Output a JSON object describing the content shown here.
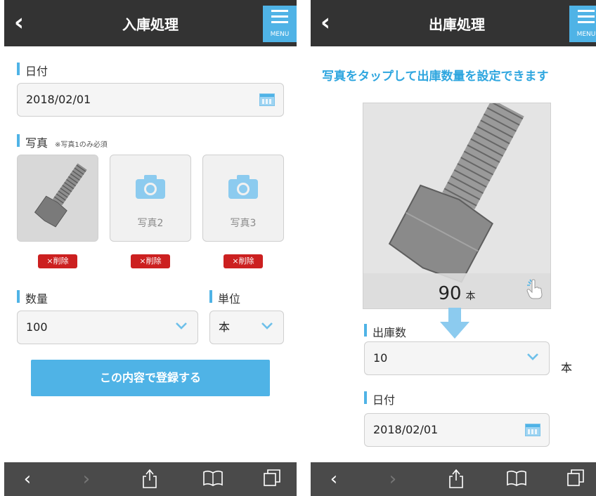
{
  "left": {
    "header_title": "入庫処理",
    "menu_label": "MENU",
    "date_label": "日付",
    "date_value": "2018/02/01",
    "photo_label": "写真",
    "photo_note": "※写真1のみ必須",
    "photo2_label": "写真2",
    "photo3_label": "写真3",
    "delete_label": "×削除",
    "qty_label": "数量",
    "qty_value": "100",
    "unit_label": "単位",
    "unit_value": "本",
    "submit_label": "この内容で登録する"
  },
  "right": {
    "header_title": "出庫処理",
    "menu_label": "MENU",
    "hint": "写真をタップして出庫数量を設定できます",
    "photo_qty": "90",
    "photo_unit": "本",
    "out_label": "出庫数",
    "out_value": "10",
    "out_unit": "本",
    "date_label": "日付",
    "date_value": "2018/02/01"
  },
  "colors": {
    "accent": "#4fb3e6",
    "header": "#333333",
    "delete": "#cc2020",
    "browser_bar": "#4a4a4a"
  },
  "icons": [
    "back-icon",
    "menu-icon",
    "calendar-icon",
    "camera-icon",
    "chevron-down-icon",
    "arrow-down-icon",
    "hand-pointer-icon",
    "browser-back-icon",
    "browser-forward-icon",
    "share-icon",
    "bookmarks-icon",
    "tabs-icon"
  ]
}
